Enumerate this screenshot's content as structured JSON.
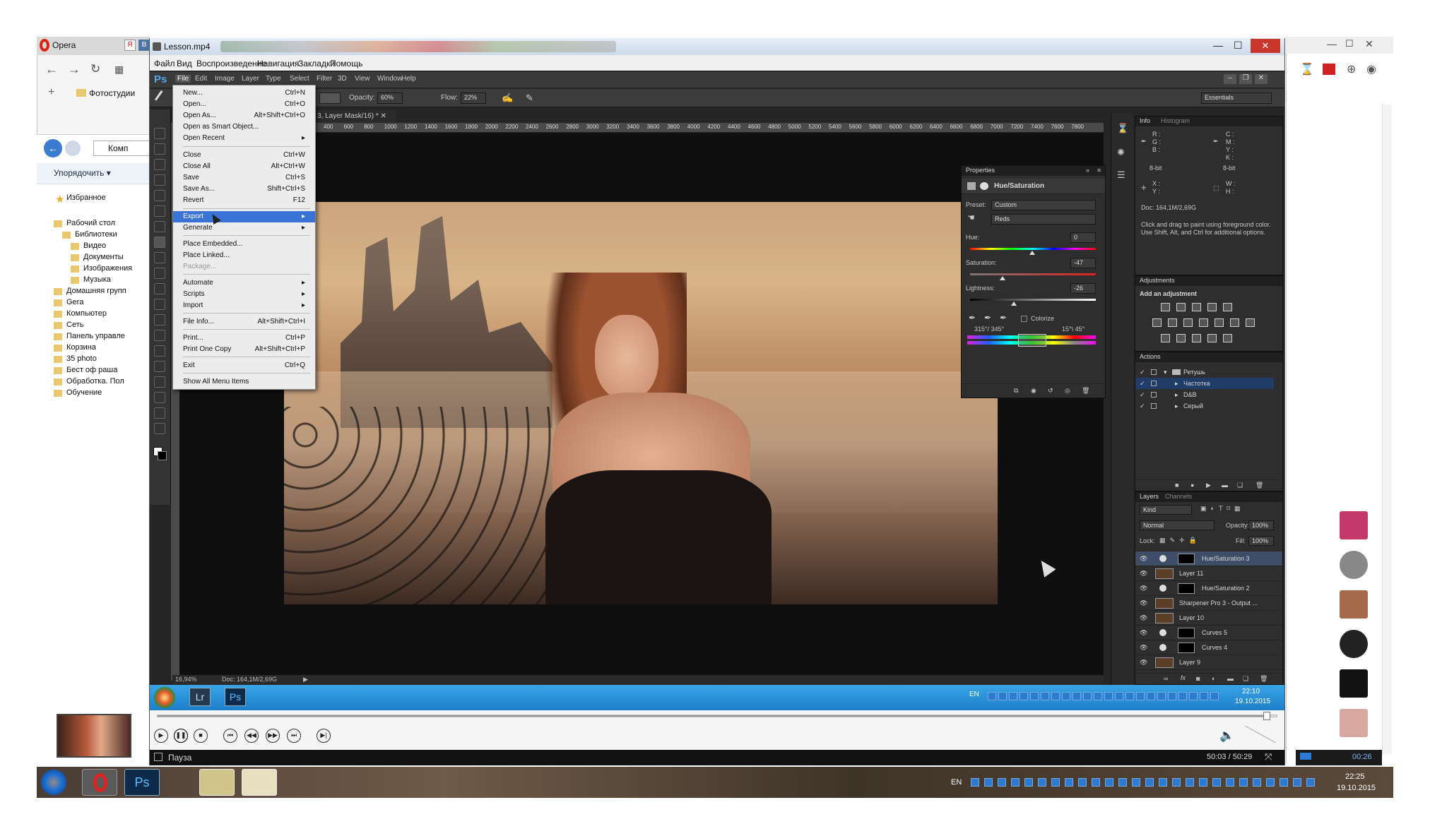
{
  "opera": {
    "tab_label": "Opera",
    "bookmark_text": "Фотостудии"
  },
  "explorer": {
    "organize_label": "Упорядочить ▾",
    "address_text": "Комп",
    "tree": [
      "Избранное",
      "Рабочий стол",
      "Библиотеки",
      "Видео",
      "Документы",
      "Изображения",
      "Музыка",
      "Домашняя групп",
      "Gera",
      "Компьютер",
      "Сеть",
      "Панель управле",
      "Корзина",
      "35 photo",
      "Бест оф раша",
      "Обработка. Пол",
      "Обучение"
    ]
  },
  "player": {
    "window_title": "Lesson.mp4",
    "menu": [
      "Файл",
      "Вид",
      "Воспроизведение",
      "Навигация",
      "Закладки",
      "Помощь"
    ],
    "status_text": "Пауза",
    "time_text": "50:03 / 50:29"
  },
  "photoshop": {
    "logo": "Ps",
    "menu": [
      "File",
      "Edit",
      "Image",
      "Layer",
      "Type",
      "Select",
      "Filter",
      "3D",
      "View",
      "Window",
      "Help"
    ],
    "options": {
      "opacity_label": "Opacity:",
      "opacity_value": "60%",
      "flow_label": "Flow:",
      "flow_value": "22%",
      "workspace": "Essentials"
    },
    "doc_tab": "3, Layer Mask/16) *",
    "ruler": [
      "400",
      "600",
      "800",
      "1000",
      "1200",
      "1400",
      "1600",
      "1800",
      "2000",
      "2200",
      "2400",
      "2600",
      "2800",
      "3000",
      "3200",
      "3400",
      "3600",
      "3800",
      "4000",
      "4200",
      "4400",
      "4600",
      "4800",
      "5000",
      "5200",
      "5400",
      "5600",
      "5800",
      "6000",
      "6200",
      "6400",
      "6600",
      "6800",
      "7000",
      "7200",
      "7400",
      "7600",
      "7800"
    ],
    "status": {
      "zoom": "16,94%",
      "doc": "Doc: 164,1M/2,69G"
    },
    "file_menu": [
      {
        "label": "New...",
        "shortcut": "Ctrl+N"
      },
      {
        "label": "Open...",
        "shortcut": "Ctrl+O"
      },
      {
        "label": "Open As...",
        "shortcut": "Alt+Shift+Ctrl+O"
      },
      {
        "label": "Open as Smart Object...",
        "shortcut": ""
      },
      {
        "label": "Open Recent",
        "shortcut": "▸"
      },
      {
        "label": "Close",
        "shortcut": "Ctrl+W"
      },
      {
        "label": "Close All",
        "shortcut": "Alt+Ctrl+W"
      },
      {
        "label": "Save",
        "shortcut": "Ctrl+S"
      },
      {
        "label": "Save As...",
        "shortcut": "Shift+Ctrl+S"
      },
      {
        "label": "Revert",
        "shortcut": "F12"
      },
      {
        "label": "Export",
        "shortcut": "▸"
      },
      {
        "label": "Generate",
        "shortcut": "▸"
      },
      {
        "label": "Place Embedded...",
        "shortcut": ""
      },
      {
        "label": "Place Linked...",
        "shortcut": ""
      },
      {
        "label": "Package...",
        "shortcut": ""
      },
      {
        "label": "Automate",
        "shortcut": "▸"
      },
      {
        "label": "Scripts",
        "shortcut": "▸"
      },
      {
        "label": "Import",
        "shortcut": "▸"
      },
      {
        "label": "File Info...",
        "shortcut": "Alt+Shift+Ctrl+I"
      },
      {
        "label": "Print...",
        "shortcut": "Ctrl+P"
      },
      {
        "label": "Print One Copy",
        "shortcut": "Alt+Shift+Ctrl+P"
      },
      {
        "label": "Exit",
        "shortcut": "Ctrl+Q"
      },
      {
        "label": "Show All Menu Items",
        "shortcut": ""
      }
    ],
    "properties": {
      "title": "Properties",
      "subtitle": "Hue/Saturation",
      "preset_label": "Preset:",
      "preset_value": "Custom",
      "channel": "Reds",
      "hue_label": "Hue:",
      "hue_value": "0",
      "saturation_label": "Saturation:",
      "saturation_value": "-47",
      "lightness_label": "Lightness:",
      "lightness_value": "-26",
      "colorize_label": "Colorize",
      "range_left": "315°/ 345°",
      "range_right": "15°\\ 45°"
    },
    "info": {
      "tabs": [
        "Info",
        "Histogram"
      ],
      "rgb": [
        "R :",
        "G :",
        "B :"
      ],
      "cmyk": [
        "C :",
        "M :",
        "Y :",
        "K :"
      ],
      "bit_left": "8-bit",
      "bit_right": "8-bit",
      "xy": [
        "X :",
        "Y :"
      ],
      "wh": [
        "W :",
        "H :"
      ],
      "doc": "Doc: 164,1M/2,69G",
      "hint": "Click and drag to paint using foreground color. Use Shift, Alt, and Ctrl for additional options."
    },
    "adjustments": {
      "title": "Adjustments",
      "subtitle": "Add an adjustment"
    },
    "actions": {
      "title": "Actions",
      "items": [
        "Ретушь",
        "Частотка",
        "D&B",
        "Серый"
      ]
    },
    "layers": {
      "tabs": [
        "Layers",
        "Channels"
      ],
      "kind": "Kind",
      "blend": "Normal",
      "opacity_label": "Opacity:",
      "opacity_value": "100%",
      "lock_label": "Lock:",
      "fill_label": "Fill:",
      "fill_value": "100%",
      "items": [
        "Hue/Saturation 3",
        "Layer 11",
        "Hue/Saturation 2",
        "Sharpener Pro 3 - Output ...",
        "Layer 10",
        "Curves 5",
        "Curves 4",
        "Layer 9"
      ]
    }
  },
  "inner_taskbar": {
    "apps": [
      "Lr",
      "Ps"
    ],
    "lang": "EN",
    "time": "22:10",
    "date": "19.10.2015"
  },
  "outer_taskbar": {
    "lang": "EN",
    "time": "22:25",
    "date": "19.10.2015"
  },
  "right_browser": {
    "timer": "00:26"
  }
}
